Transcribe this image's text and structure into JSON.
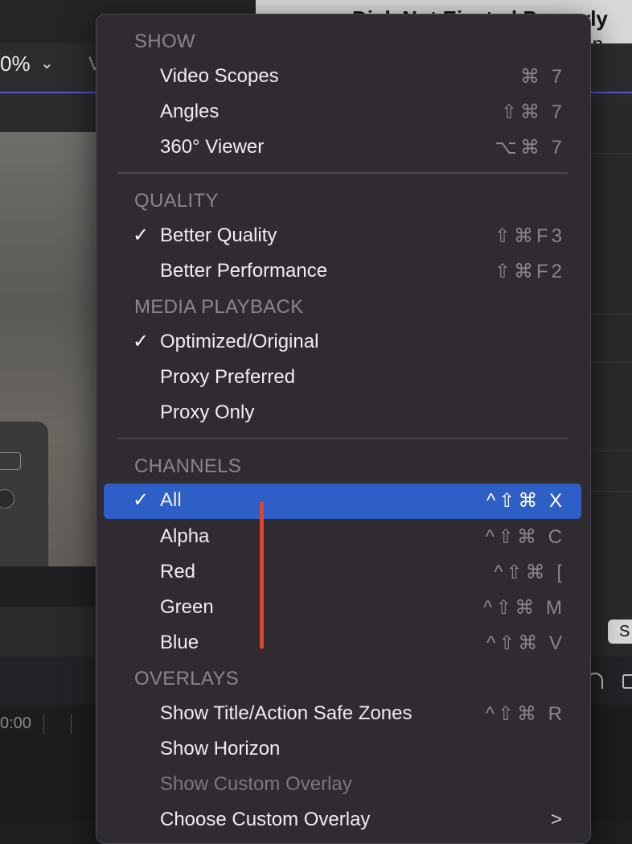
{
  "background": {
    "notification": {
      "title": "Disk Not Ejected Properly",
      "body_fragment": "conn"
    },
    "viewer": {
      "zoom": "0%",
      "view_fragment": "V"
    },
    "timecode": "0:00",
    "right_button_fragment": "S"
  },
  "menu": {
    "sections": {
      "show": "SHOW",
      "quality": "QUALITY",
      "media_playback": "MEDIA PLAYBACK",
      "channels": "CHANNELS",
      "overlays": "OVERLAYS"
    },
    "items": {
      "video_scopes": {
        "label": "Video Scopes",
        "shortcut": "⌘ 7"
      },
      "angles": {
        "label": "Angles",
        "shortcut": "⇧⌘ 7"
      },
      "viewer_360": {
        "label": "360° Viewer",
        "shortcut": "⌥⌘ 7"
      },
      "better_quality": {
        "label": "Better Quality",
        "shortcut": "⇧⌘F3",
        "checked": true
      },
      "better_performance": {
        "label": "Better Performance",
        "shortcut": "⇧⌘F2"
      },
      "optimized_original": {
        "label": "Optimized/Original",
        "checked": true
      },
      "proxy_preferred": {
        "label": "Proxy Preferred"
      },
      "proxy_only": {
        "label": "Proxy Only"
      },
      "all": {
        "label": "All",
        "shortcut": "^⇧⌘ X",
        "checked": true,
        "selected": true
      },
      "alpha": {
        "label": "Alpha",
        "shortcut": "^⇧⌘ C"
      },
      "red": {
        "label": "Red",
        "shortcut": "^⇧⌘ ["
      },
      "green": {
        "label": "Green",
        "shortcut": "^⇧⌘ M"
      },
      "blue": {
        "label": "Blue",
        "shortcut": "^⇧⌘ V"
      },
      "show_safe_zones": {
        "label": "Show Title/Action Safe Zones",
        "shortcut": "^⇧⌘ R"
      },
      "show_horizon": {
        "label": "Show Horizon"
      },
      "show_custom_overlay": {
        "label": "Show Custom Overlay",
        "disabled": true
      },
      "choose_custom_overlay": {
        "label": "Choose Custom Overlay",
        "submenu": ">"
      }
    },
    "check_glyph": "✓"
  },
  "colors": {
    "selection": "#2d5fc6",
    "annotation": "#e0452e",
    "menu_bg": "#2f2b31"
  }
}
